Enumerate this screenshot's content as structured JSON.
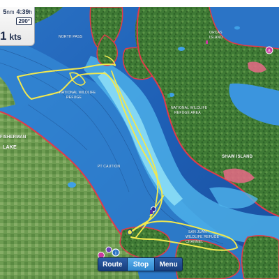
{
  "status": {
    "distance_value": "5",
    "distance_unit": "nm",
    "time_remaining": "4:39",
    "time_unit": "h",
    "heading": "290°",
    "speed_value": "1",
    "speed_unit": "kts"
  },
  "toolbar": {
    "route_label": "Route",
    "stop_label": "Stop",
    "menu_label": "Menu"
  },
  "map_labels": {
    "north_pass": "NORTH PASS",
    "national_wildlife_1": "NATIONAL WILDLIFE",
    "refuge_1": "REFUGE",
    "national_wildlife_2": "NATIONAL WILDLIFE",
    "refuge_2": "REFUGE AREA",
    "shaw_island": "SHAW ISLAND",
    "lake": "LAKE",
    "fisherman": "FISHERMAN",
    "san_juan": "SAN JUAN",
    "wildlife_refuge_3": "WILDLIFE REFUGE",
    "orcas": "ORCAS",
    "island": "ISLAND",
    "pt_caution": "PT CAUTION",
    "channel": "CHANNEL"
  },
  "colors": {
    "deep_water": "#1f5fb3",
    "mid_water": "#3fa0e6",
    "shallow_water": "#7ed7f5",
    "land_green": "#4e8a3c",
    "land_dark": "#2f6a2a",
    "land_light": "#8cb86a",
    "shoreline": "#e23a4a",
    "track": "#f2e84e",
    "toolbar_blue": "#1f4d94",
    "toolbar_active": "#3b98dd"
  },
  "icons": [
    "compass-icon",
    "marina-icon",
    "anchorage-icon",
    "info-icon",
    "fuel-icon",
    "boat-position-icon"
  ]
}
